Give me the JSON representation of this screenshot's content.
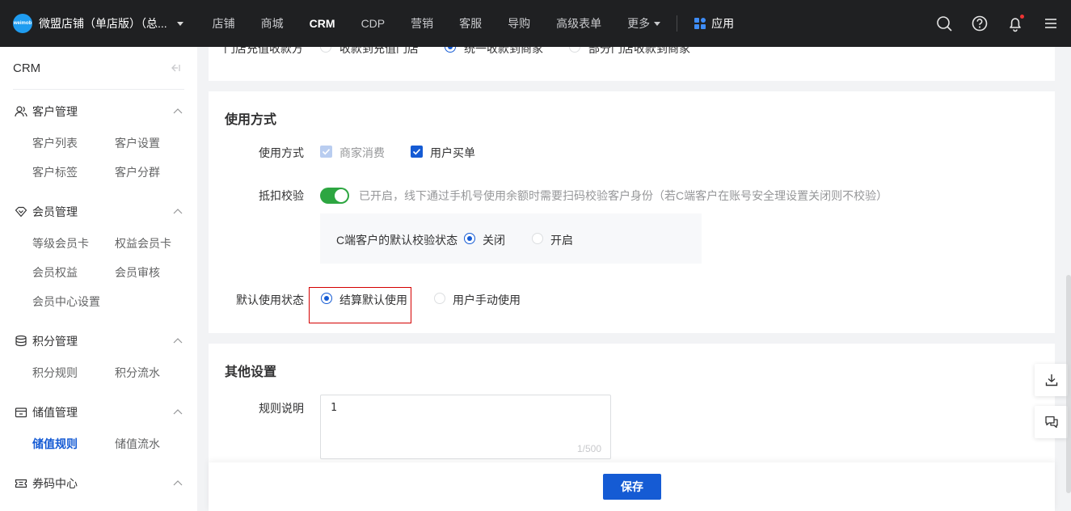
{
  "topbar": {
    "logo_text": "weimob",
    "shop_name": "微盟店铺（单店版）（总...",
    "nav": [
      "店铺",
      "商城",
      "CRM",
      "CDP",
      "营销",
      "客服",
      "导购",
      "高级表单"
    ],
    "active_nav": "CRM",
    "more_label": "更多",
    "apps_label": "应用"
  },
  "sidebar": {
    "title": "CRM",
    "groups": [
      {
        "label": "客户管理",
        "items": [
          "客户列表",
          "客户设置",
          "客户标签",
          "客户分群"
        ]
      },
      {
        "label": "会员管理",
        "items": [
          "等级会员卡",
          "权益会员卡",
          "会员权益",
          "会员审核",
          "会员中心设置"
        ]
      },
      {
        "label": "积分管理",
        "items": [
          "积分规则",
          "积分流水"
        ]
      },
      {
        "label": "储值管理",
        "items": [
          "储值规则",
          "储值流水"
        ]
      },
      {
        "label": "券码中心",
        "items": []
      }
    ],
    "active_item": "储值规则"
  },
  "top_section": {
    "label": "门店充值收款方",
    "options": [
      "收款到充值门店",
      "统一收款到商家",
      "部分门店收款到商家"
    ],
    "selected": 1
  },
  "usage": {
    "title": "使用方式",
    "method_label": "使用方式",
    "method_options": [
      {
        "label": "商家消费",
        "checked": true,
        "disabled": true
      },
      {
        "label": "用户买单",
        "checked": true,
        "disabled": false
      }
    ],
    "verify_label": "抵扣校验",
    "verify_on": true,
    "verify_hint": "已开启，线下通过手机号使用余额时需要扫码校验客户身份（若C端客户在账号安全理设置关闭则不校验）",
    "default_verify_label": "C端客户的默认校验状态",
    "default_verify_options": [
      "关闭",
      "开启"
    ],
    "default_verify_selected": 0,
    "default_state_label": "默认使用状态",
    "default_state_options": [
      "结算默认使用",
      "用户手动使用"
    ],
    "default_state_selected": 0
  },
  "other": {
    "title": "其他设置",
    "rule_label": "规则说明",
    "rule_value": "1",
    "rule_counter": "1/500"
  },
  "footer": {
    "save_label": "保存"
  },
  "colors": {
    "primary": "#155bd4",
    "switch_on": "#2da641",
    "topbar": "#1f2022",
    "highlight": "#d40000"
  }
}
